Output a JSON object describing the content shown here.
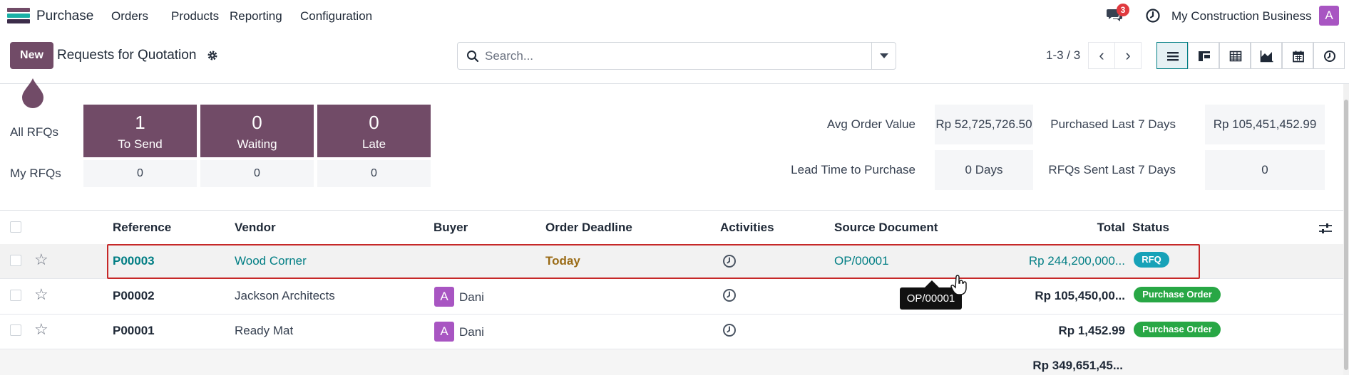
{
  "nav": {
    "app_name": "Purchase",
    "menu": [
      "Orders",
      "Products",
      "Reporting",
      "Configuration"
    ],
    "chat_badge": "3",
    "company": "My Construction Business",
    "avatar_letter": "A"
  },
  "control": {
    "new_label": "New",
    "title": "Requests for Quotation",
    "search_placeholder": "Search...",
    "pager": "1-3 / 3",
    "views": [
      "list-icon",
      "kanban-icon",
      "pivot-icon",
      "graph-icon",
      "calendar-icon",
      "activity-icon"
    ]
  },
  "dashboard": {
    "all_rfqs_label": "All RFQs",
    "my_rfqs_label": "My RFQs",
    "tiles": [
      {
        "value": "1",
        "label": "To Send",
        "mine": "0"
      },
      {
        "value": "0",
        "label": "Waiting",
        "mine": "0"
      },
      {
        "value": "0",
        "label": "Late",
        "mine": "0"
      }
    ],
    "kpis": [
      {
        "label": "Avg Order Value",
        "value": "Rp 52,725,726.50"
      },
      {
        "label": "Purchased Last 7 Days",
        "value": "Rp 105,451,452.99"
      },
      {
        "label": "Lead Time to Purchase",
        "value": "0 Days"
      },
      {
        "label": "RFQs Sent Last 7 Days",
        "value": "0"
      }
    ]
  },
  "table": {
    "headers": {
      "reference": "Reference",
      "vendor": "Vendor",
      "buyer": "Buyer",
      "deadline": "Order Deadline",
      "activities": "Activities",
      "source": "Source Document",
      "total": "Total",
      "status": "Status"
    },
    "rows": [
      {
        "reference": "P00003",
        "vendor": "Wood Corner",
        "buyer": "",
        "buyer_avatar": "",
        "deadline": "Today",
        "source": "OP/00001",
        "total": "Rp 244,200,000...",
        "status": "RFQ"
      },
      {
        "reference": "P00002",
        "vendor": "Jackson Architects",
        "buyer": "Dani",
        "buyer_avatar": "A",
        "deadline": "",
        "source": "",
        "total": "Rp 105,450,00...",
        "status": "Purchase Order"
      },
      {
        "reference": "P00001",
        "vendor": "Ready Mat",
        "buyer": "Dani",
        "buyer_avatar": "A",
        "deadline": "",
        "source": "",
        "total": "Rp 1,452.99",
        "status": "Purchase Order"
      }
    ],
    "grand_total": "Rp 349,651,45..."
  },
  "tooltip": "OP/00001",
  "colors": {
    "brand": "#714b67",
    "link": "#017e84",
    "rfq_tag": "#17a2b8",
    "po_tag": "#28a745",
    "highlight": "#c62828"
  }
}
